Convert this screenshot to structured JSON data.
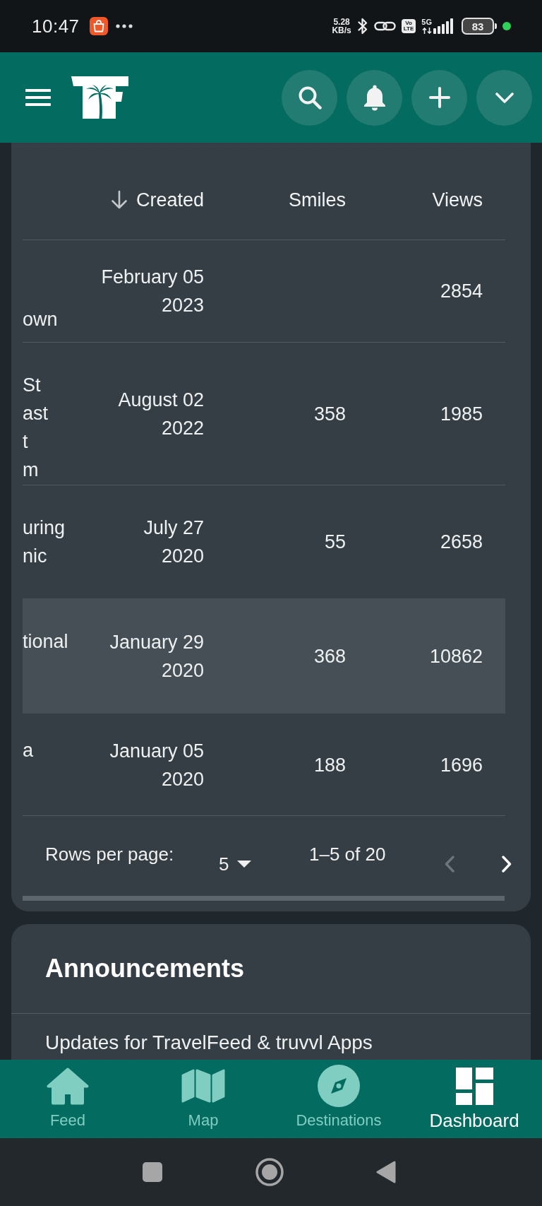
{
  "status_bar": {
    "time": "10:47",
    "network_speed": [
      "5.28",
      "KB/s"
    ],
    "volte": [
      "Vo",
      "LTE"
    ],
    "network_type": "5G",
    "battery": "83"
  },
  "table": {
    "columns": [
      {
        "label": "Created",
        "sorted_descending": true
      },
      {
        "label": "Smiles",
        "sorted_descending": false
      },
      {
        "label": "Views",
        "sorted_descending": false
      }
    ],
    "rows": [
      {
        "column_1": [
          "own"
        ],
        "created": [
          "February 05",
          "2023"
        ],
        "views": "2854",
        "selected": false
      },
      {
        "column_1": [
          "St",
          "ast",
          "t",
          "m"
        ],
        "created": [
          "August 02",
          "2022"
        ],
        "smiles": "358",
        "views": "1985",
        "selected": false
      },
      {
        "column_1": [
          "uring",
          "nic"
        ],
        "created": [
          "July 27",
          "2020"
        ],
        "smiles": "55",
        "views": "2658",
        "selected": false
      },
      {
        "column_1": [
          "tional"
        ],
        "created": [
          "January 29",
          "2020"
        ],
        "smiles": "368",
        "views": "10862",
        "selected": true
      },
      {
        "column_1": [
          "a"
        ],
        "created": [
          "January 05",
          "2020"
        ],
        "smiles": "188",
        "views": "1696",
        "selected": false
      }
    ],
    "pagination": {
      "rows_per_page_label": "Rows per page:",
      "rows_per_page": "5",
      "range": "1–5 of 20",
      "previous": {
        "disabled": true
      },
      "next": {
        "disabled": false
      }
    }
  },
  "announcements": {
    "title": "Announcements",
    "items": [
      {
        "title": "Updates for TravelFeed & truvvl Apps"
      }
    ]
  },
  "bottom_nav": [
    {
      "label": "Feed",
      "selected": false
    },
    {
      "label": "Map",
      "selected": false
    },
    {
      "label": "Destinations",
      "selected": false
    },
    {
      "label": "Dashboard",
      "selected": true
    }
  ]
}
